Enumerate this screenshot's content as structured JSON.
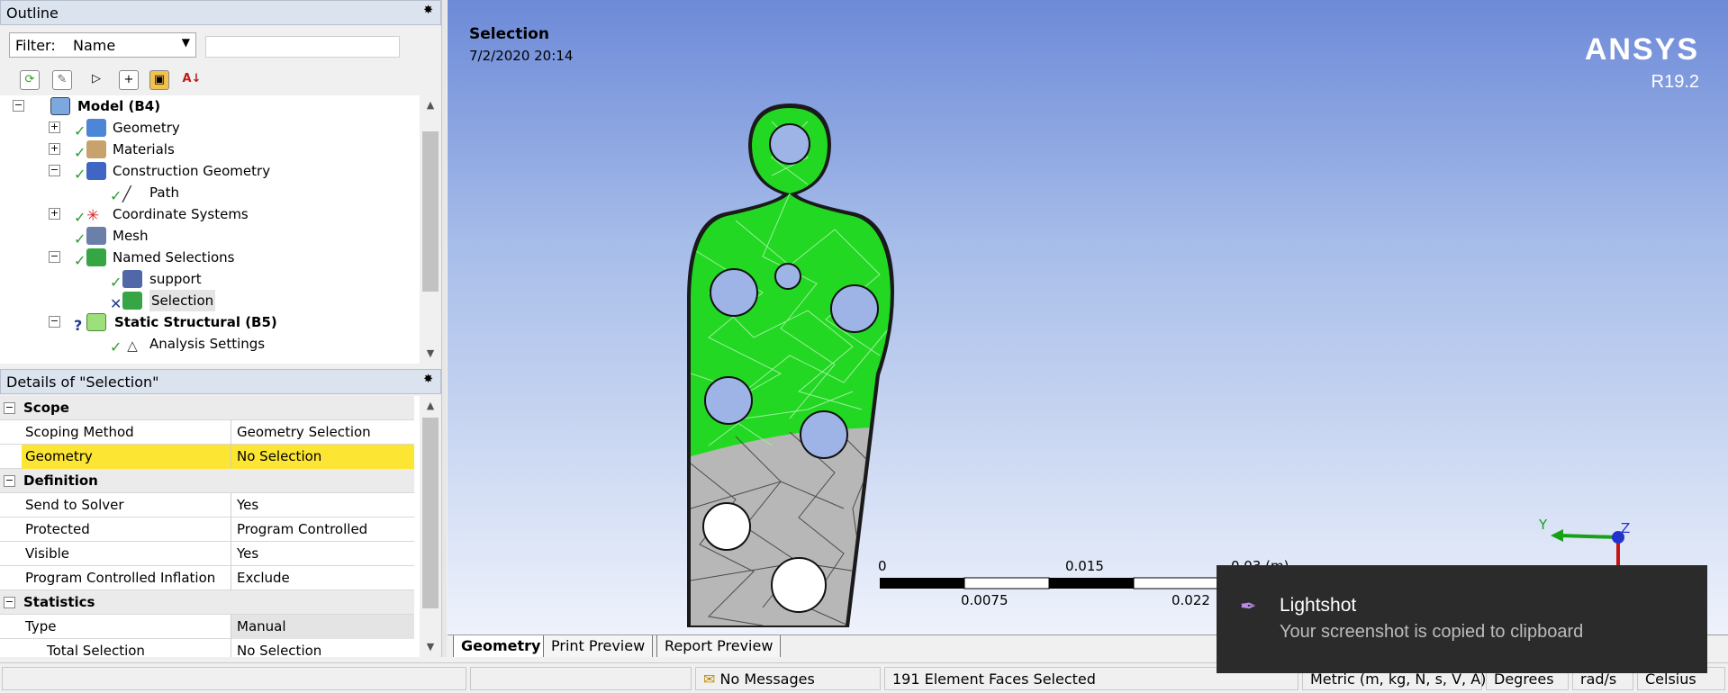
{
  "outline": {
    "title": "Outline",
    "pin": "✸",
    "filter": {
      "label": "Filter:",
      "value": "Name",
      "text": ""
    },
    "toolbar": [
      "refresh",
      "clear",
      "goto",
      "expand",
      "folder",
      "sort"
    ],
    "tree": [
      {
        "label": "Model (B4)",
        "bold": true
      },
      {
        "label": "Geometry"
      },
      {
        "label": "Materials"
      },
      {
        "label": "Construction Geometry"
      },
      {
        "label": "Path"
      },
      {
        "label": "Coordinate Systems"
      },
      {
        "label": "Mesh"
      },
      {
        "label": "Named Selections"
      },
      {
        "label": "support"
      },
      {
        "label": "Selection",
        "selected": true
      },
      {
        "label": "Static Structural (B5)",
        "bold": true
      },
      {
        "label": "Analysis Settings"
      }
    ]
  },
  "details": {
    "title": "Details of \"Selection\"",
    "pin": "✸",
    "rows": [
      {
        "section": "Scope"
      },
      {
        "label": "Scoping Method",
        "value": "Geometry Selection"
      },
      {
        "label": "Geometry",
        "value": "No Selection",
        "highlight": true
      },
      {
        "section": "Definition"
      },
      {
        "label": "Send to Solver",
        "value": "Yes"
      },
      {
        "label": "Protected",
        "value": "Program Controlled"
      },
      {
        "label": "Visible",
        "value": "Yes"
      },
      {
        "label": "Program Controlled Inflation",
        "value": "Exclude"
      },
      {
        "section": "Statistics"
      },
      {
        "label": "Type",
        "value": "Manual"
      },
      {
        "label": "Total Selection",
        "value": "No Selection"
      }
    ]
  },
  "viewport": {
    "title": "Selection",
    "date": "7/2/2020 20:14",
    "brand": "ANSYS",
    "version": "R19.2",
    "scale": {
      "top": [
        "0",
        "0.015",
        "0.03 (m)"
      ],
      "bottom": [
        "0.0075",
        "0.022"
      ]
    },
    "triad": {
      "y": "Y",
      "z": "Z"
    },
    "tabs": [
      "Geometry",
      "Print Preview",
      "Report Preview"
    ]
  },
  "statusbar": {
    "messages": "No Messages",
    "selection": "191 Element Faces Selected",
    "units": "Metric (m, kg, N, s, V, A)",
    "angle": "Degrees",
    "rate": "rad/s",
    "temperature": "Celsius"
  },
  "toast": {
    "title": "Lightshot",
    "message": "Your screenshot is copied to clipboard"
  },
  "colors": {
    "selected_face": "#22d822",
    "mesh": "#b4b4b4",
    "highlight_row": "#fde533",
    "toast_bg": "#2b2b2b"
  }
}
